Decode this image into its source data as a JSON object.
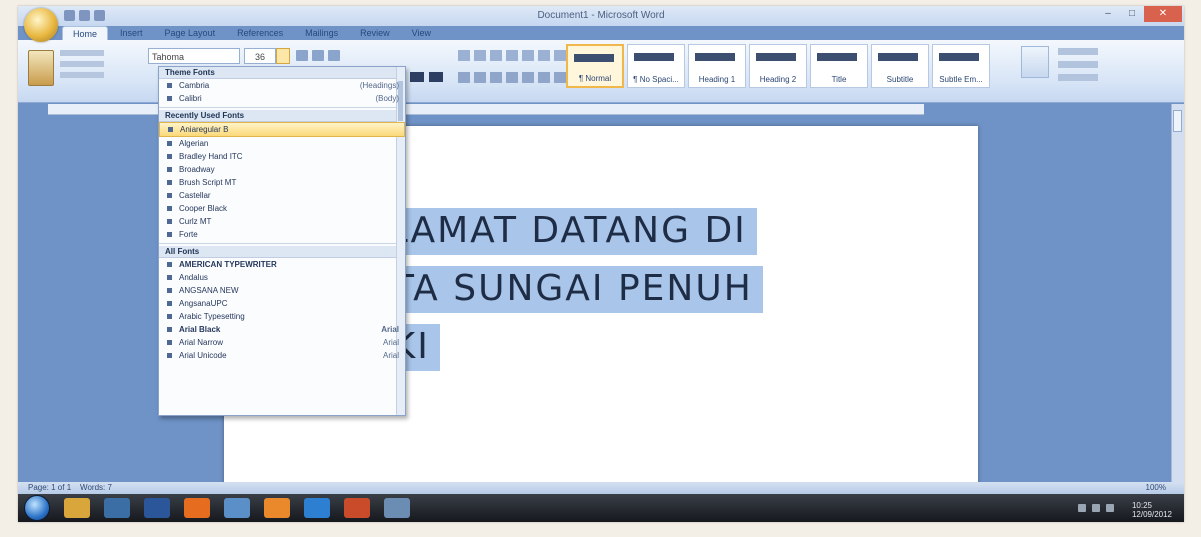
{
  "window": {
    "title": "Document1 - Microsoft Word",
    "controls": {
      "minimize": "–",
      "maximize": "□",
      "close": "✕"
    }
  },
  "ribbon": {
    "tabs": [
      {
        "label": "Home",
        "active": true
      },
      {
        "label": "Insert"
      },
      {
        "label": "Page Layout"
      },
      {
        "label": "References"
      },
      {
        "label": "Mailings"
      },
      {
        "label": "Review"
      },
      {
        "label": "View"
      }
    ],
    "font_name": "Tahoma",
    "font_size": "36",
    "styles": [
      {
        "label": "¶ Normal",
        "active": true
      },
      {
        "label": "¶ No Spaci..."
      },
      {
        "label": "Heading 1"
      },
      {
        "label": "Heading 2"
      },
      {
        "label": "Title"
      },
      {
        "label": "Subtitle"
      },
      {
        "label": "Subtle Em..."
      }
    ]
  },
  "font_menu": {
    "sections": [
      {
        "header": "Theme Fonts",
        "items": [
          {
            "label": "Cambria",
            "shortcut": "(Headings)"
          },
          {
            "label": "Calibri",
            "shortcut": "(Body)"
          }
        ]
      },
      {
        "header": "Recently Used Fonts",
        "items": [
          {
            "label": "Aniaregular B",
            "highlight": true
          },
          {
            "label": "Algerian"
          },
          {
            "label": "Bradley Hand ITC"
          },
          {
            "label": "Broadway"
          },
          {
            "label": "Brush Script MT"
          },
          {
            "label": "Castellar"
          },
          {
            "label": "Cooper Black"
          },
          {
            "label": "Curlz MT"
          },
          {
            "label": "Forte"
          }
        ]
      },
      {
        "header": "All Fonts",
        "items": [
          {
            "label": "AMERICAN TYPEWRITER",
            "bold": true
          },
          {
            "label": "Andalus"
          },
          {
            "label": "ANGSANA NEW"
          },
          {
            "label": "AngsanaUPC"
          },
          {
            "label": "Arabic Typesetting"
          },
          {
            "label": "Arial Black",
            "bold": true,
            "shortcut": "Arial"
          },
          {
            "label": "Arial Narrow",
            "shortcut": "Arial"
          },
          {
            "label": "Arial Unicode",
            "shortcut": "Arial"
          }
        ]
      }
    ]
  },
  "document": {
    "lines": [
      "SELAMAT DATANG DI",
      "KOTA SUNGAI PENUH",
      "JIUKI"
    ]
  },
  "status": {
    "page": "Page: 1 of 1",
    "words": "Words: 7",
    "zoom": "100%"
  },
  "taskbar": {
    "time": "10:25",
    "date": "12/09/2012",
    "apps": [
      {
        "icon": "folder-icon",
        "color": "#d9a63b"
      },
      {
        "icon": "media-player-icon",
        "color": "#3b6ea5"
      },
      {
        "icon": "word-icon",
        "color": "#2b579a"
      },
      {
        "icon": "firefox-icon",
        "color": "#e66c1f"
      },
      {
        "icon": "paint-icon",
        "color": "#5a8fc7"
      },
      {
        "icon": "vlc-icon",
        "color": "#e9892c"
      },
      {
        "icon": "ie-icon",
        "color": "#2d7fd1"
      },
      {
        "icon": "powerpoint-icon",
        "color": "#c94b2a"
      },
      {
        "icon": "network-icon",
        "color": "#6b8db3"
      }
    ]
  },
  "colors": {
    "accent": "#2b579a",
    "selection": "#a9c6ea",
    "highlight": "#fbd979"
  }
}
